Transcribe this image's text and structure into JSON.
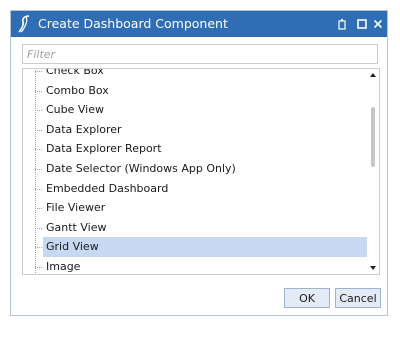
{
  "window": {
    "title": "Create Dashboard Component"
  },
  "filter": {
    "placeholder": "Filter",
    "value": ""
  },
  "component_list": {
    "items": [
      {
        "label": "Check Box",
        "selected": false
      },
      {
        "label": "Combo Box",
        "selected": false
      },
      {
        "label": "Cube View",
        "selected": false
      },
      {
        "label": "Data Explorer",
        "selected": false
      },
      {
        "label": "Data Explorer Report",
        "selected": false
      },
      {
        "label": "Date Selector (Windows App Only)",
        "selected": false
      },
      {
        "label": "Embedded Dashboard",
        "selected": false
      },
      {
        "label": "File Viewer",
        "selected": false
      },
      {
        "label": "Gantt View",
        "selected": false
      },
      {
        "label": "Grid View",
        "selected": true
      },
      {
        "label": "Image",
        "selected": false
      }
    ]
  },
  "buttons": {
    "ok_label": "OK",
    "cancel_label": "Cancel"
  },
  "colors": {
    "titlebar": "#2f6db5",
    "selection": "#c7d8f2",
    "button_bg": "#e3ebf7"
  },
  "icons": {
    "title_logo": "app-logo-icon",
    "restore": "restore-window-icon",
    "maximize": "maximize-icon",
    "close": "close-icon",
    "scroll_up": "scroll-up-arrow-icon",
    "scroll_down": "scroll-down-arrow-icon"
  }
}
